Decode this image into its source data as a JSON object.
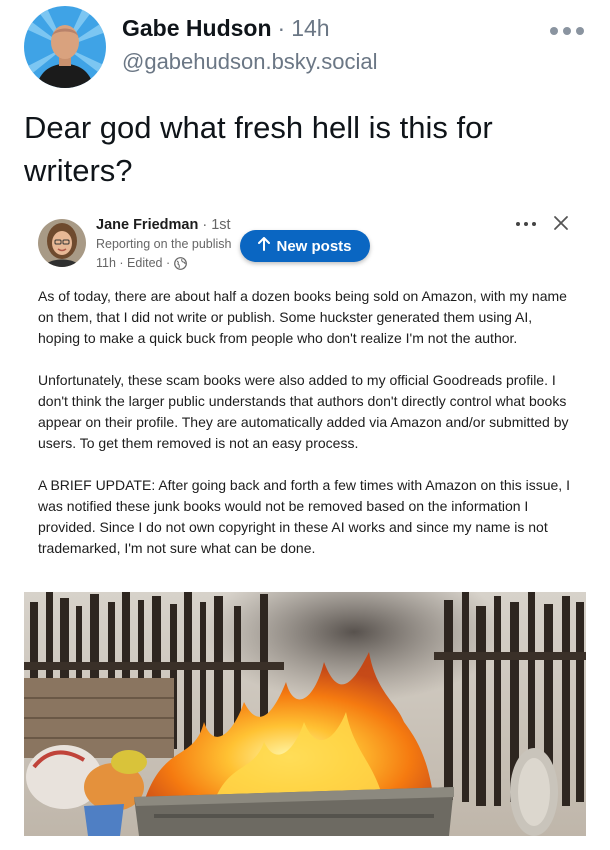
{
  "post": {
    "author_name": "Gabe Hudson",
    "separator": "·",
    "time": "14h",
    "handle": "@gabehudson.bsky.social",
    "text": "Dear god what fresh hell is this for writers?"
  },
  "embed": {
    "author_name": "Jane Friedman",
    "degree": "· 1st",
    "headline": "Reporting on the publish",
    "meta": "11h · Edited ·",
    "new_posts_label": "New posts",
    "paragraphs": [
      "As of today, there are about half a dozen books being sold on Amazon, with my name on them, that I did not write or publish. Some huckster generated them using AI, hoping to make a quick buck from people who don't realize I'm not the author.",
      "Unfortunately, these scam books were also added to my official Goodreads profile. I don't think the larger public understands that authors don't directly control what books appear on their profile. They are automatically added via Amazon and/or submitted by users. To get them removed is not an easy process.",
      "A BRIEF UPDATE: After going back and forth a few times with Amazon on this issue, I was notified these junk books would not be removed based on the information I provided. Since I do not own copyright in these AI works and since my name is not trademarked, I'm not sure what can be done."
    ]
  },
  "icons": {
    "more": "more-horizontal-icon",
    "close": "close-icon",
    "arrow": "arrow-up-icon",
    "globe": "globe-icon"
  },
  "colors": {
    "linkedin_blue": "#0a66c2",
    "secondary_text": "#6b7785",
    "avatar_bg": "#3fa3e6"
  }
}
